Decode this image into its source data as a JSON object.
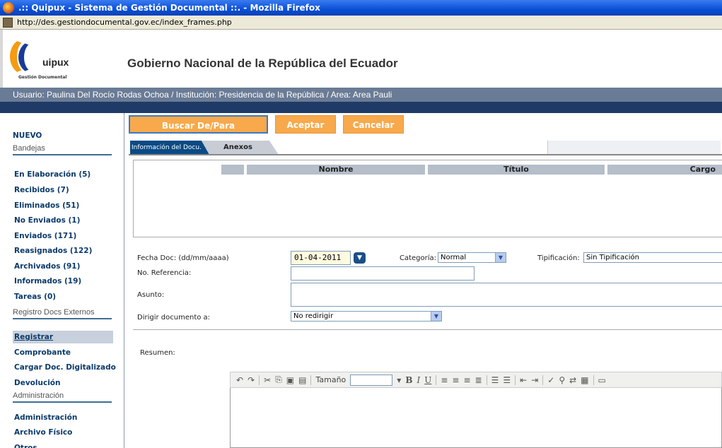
{
  "window": {
    "title": ".:: Quipux - Sistema de Gestión Documental ::. - Mozilla Firefox",
    "url": "http://des.gestiondocumental.gov.ec/index_frames.php"
  },
  "header": {
    "logo_text": "uipux",
    "logo_sub": "Gestión Documental",
    "gov_title": "Gobierno Nacional de la República del Ecuador",
    "user_info": "Usuario: Paulina Del Rocío Rodas Ochoa / Institución: Presidencia de la República / Area: Area Pauli"
  },
  "sidebar": {
    "nuevo": "NUEVO",
    "section_bandejas": "Bandejas",
    "bandejas": [
      "En Elaboración (5)",
      "Recibidos (7)",
      "Eliminados (51)",
      "No Enviados (1)",
      "Enviados (171)",
      "Reasignados (122)",
      "Archivados (91)",
      "Informados (19)",
      "Tareas (0)"
    ],
    "section_externos": "Registro Docs Externos",
    "externos": [
      "Registrar",
      "Comprobante",
      "Cargar Doc. Digitalizado",
      "Devolución"
    ],
    "section_admin": "Administración",
    "admin": [
      "Administración",
      "Archivo Físico",
      "Otros"
    ]
  },
  "toolbar": {
    "buscar_label": "Buscar De/Para",
    "aceptar_label": "Aceptar",
    "cancelar_label": "Cancelar"
  },
  "tabs": {
    "active": "Información del Docu.",
    "inactive": "Anexos"
  },
  "table": {
    "headers": [
      "Nombre",
      "Título",
      "Cargo"
    ]
  },
  "form": {
    "fecha_label": "Fecha Doc: (dd/mm/aaaa)",
    "fecha_value": "01-04-2011",
    "categoria_label": "Categoría:",
    "categoria_value": "Normal",
    "tipificacion_label": "Tipificación:",
    "tipificacion_value": "Sin Tipificación",
    "referencia_label": "No. Referencia:",
    "asunto_label": "Asunto:",
    "dirigir_label": "Dirigir documento a:",
    "dirigir_value": "No redirigir",
    "resumen_label": "Resumen:"
  },
  "editor": {
    "tamano_label": "Tamaño"
  },
  "colors": {
    "title_bar": "#0a4fd6",
    "user_bar": "#6a7b95",
    "orange_button": "#f7a94b",
    "sidebar_link": "#0b3a6b",
    "active_tab": "#0a4a85"
  }
}
